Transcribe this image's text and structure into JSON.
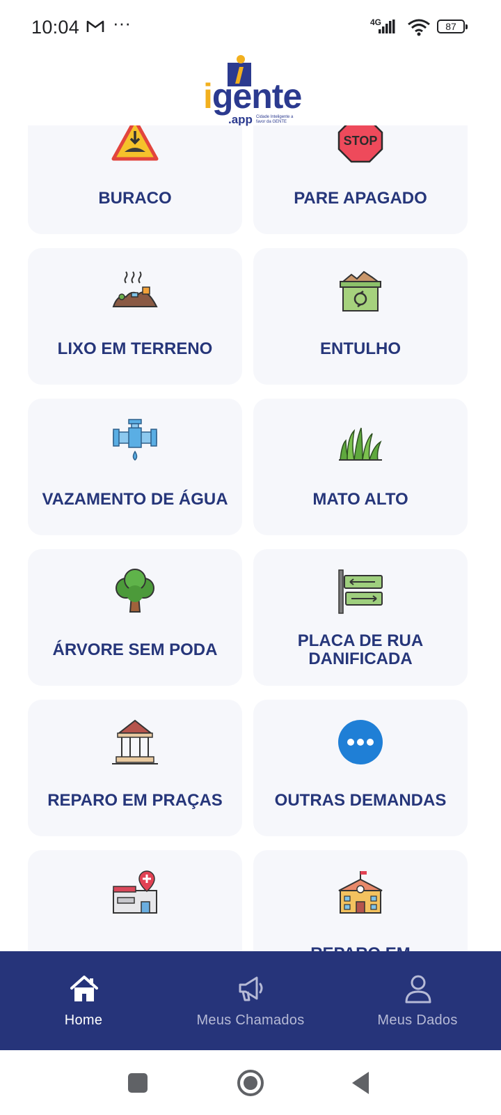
{
  "status_bar": {
    "time": "10:04",
    "network": "4G",
    "battery": "87"
  },
  "header": {
    "logo_word": "gente",
    "logo_sub": ".app",
    "logo_tag": "Cidade Inteligente a favor da GENTE"
  },
  "categories": [
    {
      "label": "BURACO",
      "icon": "pothole-warning-icon"
    },
    {
      "label": "PARE APAGADO",
      "icon": "stop-sign-icon"
    },
    {
      "label": "LIXO EM TERRENO",
      "icon": "garbage-pile-icon"
    },
    {
      "label": "ENTULHO",
      "icon": "rubble-container-icon"
    },
    {
      "label": "VAZAMENTO DE ÁGUA",
      "icon": "water-pipe-leak-icon"
    },
    {
      "label": "MATO ALTO",
      "icon": "tall-grass-icon"
    },
    {
      "label": "ÁRVORE SEM PODA",
      "icon": "tree-icon"
    },
    {
      "label": "PLACA DE RUA DANIFICADA",
      "icon": "street-sign-icon"
    },
    {
      "label": "REPARO EM PRAÇAS",
      "icon": "gazebo-icon"
    },
    {
      "label": "OUTRAS DEMANDAS",
      "icon": "more-dots-icon"
    },
    {
      "label": "",
      "icon": "health-unit-icon"
    },
    {
      "label": "REPARO EM",
      "icon": "school-building-icon"
    }
  ],
  "bottom_nav": {
    "items": [
      {
        "label": "Home",
        "icon": "home-icon",
        "active": true
      },
      {
        "label": "Meus Chamados",
        "icon": "megaphone-icon",
        "active": false
      },
      {
        "label": "Meus Dados",
        "icon": "user-icon",
        "active": false
      }
    ]
  },
  "colors": {
    "brand_blue": "#26347a",
    "brand_yellow": "#f2b01e",
    "card_bg": "#f6f7fb",
    "label_text": "#26367a"
  }
}
